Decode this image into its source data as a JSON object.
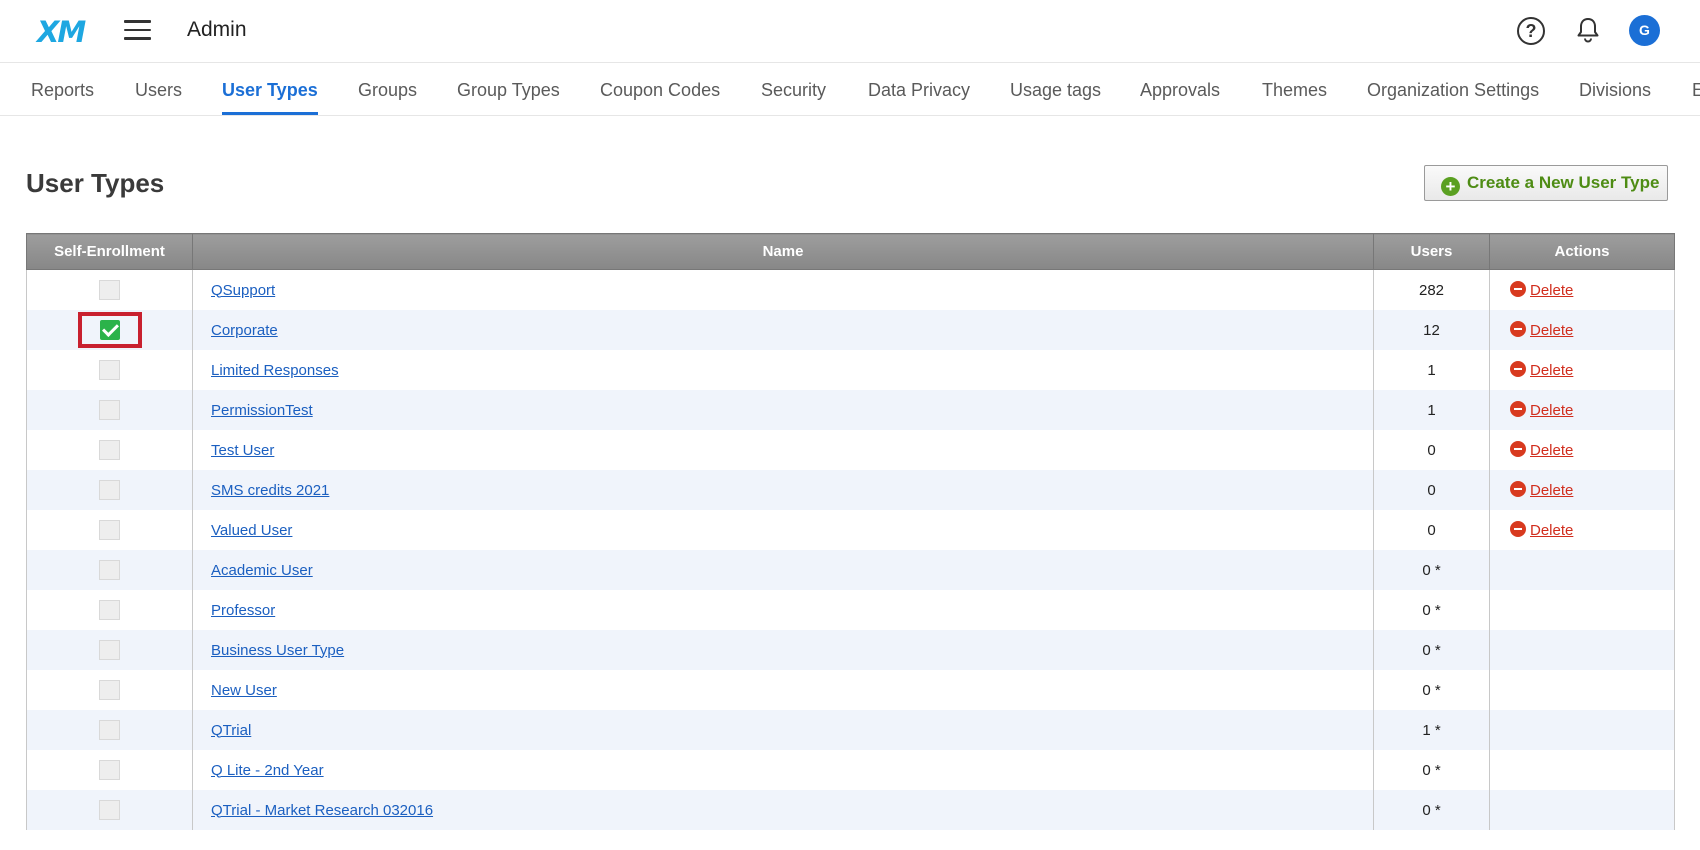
{
  "header": {
    "logo": "XM",
    "title": "Admin",
    "avatar_initial": "G"
  },
  "tabs": [
    "Reports",
    "Users",
    "User Types",
    "Groups",
    "Group Types",
    "Coupon Codes",
    "Security",
    "Data Privacy",
    "Usage tags",
    "Approvals",
    "Themes",
    "Organization Settings",
    "Divisions",
    "E"
  ],
  "active_tab": "User Types",
  "page": {
    "title": "User Types",
    "create_button": "Create a New User Type"
  },
  "table": {
    "headers": [
      "Self-Enrollment",
      "Name",
      "Users",
      "Actions"
    ],
    "rows": [
      {
        "self_enrollment": false,
        "name": "QSupport",
        "users": "282",
        "action": "Delete"
      },
      {
        "self_enrollment": true,
        "name": "Corporate",
        "users": "12",
        "action": "Delete"
      },
      {
        "self_enrollment": false,
        "name": "Limited Responses",
        "users": "1",
        "action": "Delete"
      },
      {
        "self_enrollment": false,
        "name": "PermissionTest",
        "users": "1",
        "action": "Delete"
      },
      {
        "self_enrollment": false,
        "name": "Test User",
        "users": "0",
        "action": "Delete"
      },
      {
        "self_enrollment": false,
        "name": "SMS credits 2021",
        "users": "0",
        "action": "Delete"
      },
      {
        "self_enrollment": false,
        "name": "Valued User",
        "users": "0",
        "action": "Delete"
      },
      {
        "self_enrollment": false,
        "name": "Academic User",
        "users": "0 *",
        "action": ""
      },
      {
        "self_enrollment": false,
        "name": "Professor",
        "users": "0 *",
        "action": ""
      },
      {
        "self_enrollment": false,
        "name": "Business User Type",
        "users": "0 *",
        "action": ""
      },
      {
        "self_enrollment": false,
        "name": "New User",
        "users": "0 *",
        "action": ""
      },
      {
        "self_enrollment": false,
        "name": "QTrial",
        "users": "1 *",
        "action": ""
      },
      {
        "self_enrollment": false,
        "name": "Q Lite - 2nd Year",
        "users": "0 *",
        "action": ""
      },
      {
        "self_enrollment": false,
        "name": "QTrial - Market Research 032016",
        "users": "0 *",
        "action": ""
      }
    ]
  },
  "colors": {
    "accent": "#1b6fd6",
    "highlight": "#c8202f",
    "delete": "#d12d1d",
    "create": "#4e8c14"
  }
}
